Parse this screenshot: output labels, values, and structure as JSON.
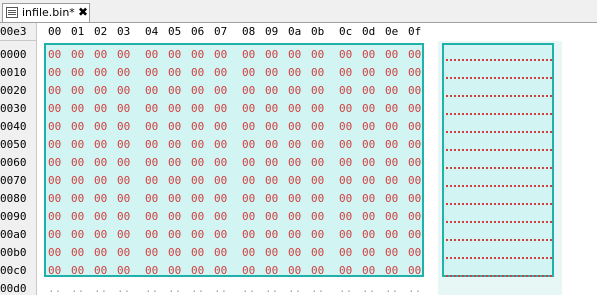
{
  "tab": {
    "title": "infile.bin*",
    "close": "✖",
    "icon": "document-icon"
  },
  "header": {
    "corner": "00e3",
    "columns": [
      "00",
      "01",
      "02",
      "03",
      "04",
      "05",
      "06",
      "07",
      "08",
      "09",
      "0a",
      "0b",
      "0c",
      "0d",
      "0e",
      "0f"
    ]
  },
  "rows": [
    {
      "offset": "0000",
      "bytes": [
        "00",
        "00",
        "00",
        "00",
        "00",
        "00",
        "00",
        "00",
        "00",
        "00",
        "00",
        "00",
        "00",
        "00",
        "00",
        "00"
      ]
    },
    {
      "offset": "0010",
      "bytes": [
        "00",
        "00",
        "00",
        "00",
        "00",
        "00",
        "00",
        "00",
        "00",
        "00",
        "00",
        "00",
        "00",
        "00",
        "00",
        "00"
      ]
    },
    {
      "offset": "0020",
      "bytes": [
        "00",
        "00",
        "00",
        "00",
        "00",
        "00",
        "00",
        "00",
        "00",
        "00",
        "00",
        "00",
        "00",
        "00",
        "00",
        "00"
      ]
    },
    {
      "offset": "0030",
      "bytes": [
        "00",
        "00",
        "00",
        "00",
        "00",
        "00",
        "00",
        "00",
        "00",
        "00",
        "00",
        "00",
        "00",
        "00",
        "00",
        "00"
      ]
    },
    {
      "offset": "0040",
      "bytes": [
        "00",
        "00",
        "00",
        "00",
        "00",
        "00",
        "00",
        "00",
        "00",
        "00",
        "00",
        "00",
        "00",
        "00",
        "00",
        "00"
      ]
    },
    {
      "offset": "0050",
      "bytes": [
        "00",
        "00",
        "00",
        "00",
        "00",
        "00",
        "00",
        "00",
        "00",
        "00",
        "00",
        "00",
        "00",
        "00",
        "00",
        "00"
      ]
    },
    {
      "offset": "0060",
      "bytes": [
        "00",
        "00",
        "00",
        "00",
        "00",
        "00",
        "00",
        "00",
        "00",
        "00",
        "00",
        "00",
        "00",
        "00",
        "00",
        "00"
      ]
    },
    {
      "offset": "0070",
      "bytes": [
        "00",
        "00",
        "00",
        "00",
        "00",
        "00",
        "00",
        "00",
        "00",
        "00",
        "00",
        "00",
        "00",
        "00",
        "00",
        "00"
      ]
    },
    {
      "offset": "0080",
      "bytes": [
        "00",
        "00",
        "00",
        "00",
        "00",
        "00",
        "00",
        "00",
        "00",
        "00",
        "00",
        "00",
        "00",
        "00",
        "00",
        "00"
      ]
    },
    {
      "offset": "0090",
      "bytes": [
        "00",
        "00",
        "00",
        "00",
        "00",
        "00",
        "00",
        "00",
        "00",
        "00",
        "00",
        "00",
        "00",
        "00",
        "00",
        "00"
      ]
    },
    {
      "offset": "00a0",
      "bytes": [
        "00",
        "00",
        "00",
        "00",
        "00",
        "00",
        "00",
        "00",
        "00",
        "00",
        "00",
        "00",
        "00",
        "00",
        "00",
        "00"
      ]
    },
    {
      "offset": "00b0",
      "bytes": [
        "00",
        "00",
        "00",
        "00",
        "00",
        "00",
        "00",
        "00",
        "00",
        "00",
        "00",
        "00",
        "00",
        "00",
        "00",
        "00"
      ]
    },
    {
      "offset": "00c0",
      "bytes": [
        "00",
        "00",
        "00",
        "00",
        "00",
        "00",
        "00",
        "00",
        "00",
        "00",
        "00",
        "00",
        "00",
        "00",
        "00",
        "00"
      ]
    },
    {
      "offset": "00d0",
      "bytes": [
        "..",
        "..",
        "..",
        "..",
        "..",
        "..",
        "..",
        "..",
        "..",
        "..",
        "..",
        "..",
        "..",
        "..",
        "..",
        ".."
      ]
    }
  ],
  "colors": {
    "selection_fill": "#d2f5f3",
    "selection_border": "#20b2aa",
    "byte_text": "#d04040"
  }
}
